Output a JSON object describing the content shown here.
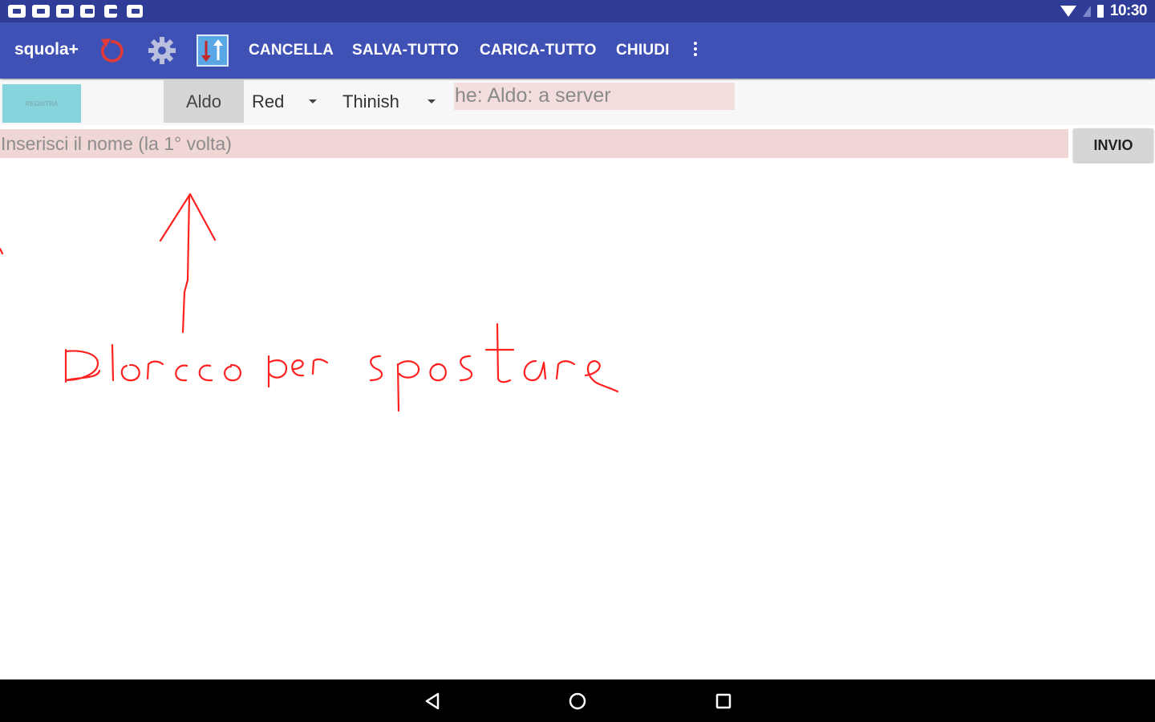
{
  "status_bar": {
    "time": "10:30",
    "notification_icons": [
      "app-notification-icon",
      "app-notification-icon",
      "app-notification-icon",
      "app-notification-icon",
      "app-notification-icon",
      "app-notification-icon"
    ],
    "icons": [
      "wifi-icon",
      "signal-icon",
      "battery-icon"
    ]
  },
  "toolbar": {
    "title": "squola+",
    "icons": [
      "undo-icon",
      "gear-icon",
      "transfer-icon"
    ],
    "actions": {
      "cancella": "CANCELLA",
      "salva_tutto": "SALVA-TUTTO",
      "carica_tutto": "CARICA-TUTTO",
      "chiudi": "CHIUDI"
    },
    "overflow_icon": "more-vert-icon"
  },
  "row1": {
    "registra_label": "REGISTRA",
    "user_name": "Aldo",
    "color_select": "Red",
    "thickness_select": "Thinish",
    "message": "he: Aldo: a server"
  },
  "row2": {
    "name_placeholder": "Inserisci il nome (la 1° volta)",
    "invio_label": "INVIO"
  },
  "canvas": {
    "stroke_color": "#ff2020",
    "handwritten_text": "blocco per spostare"
  },
  "colors": {
    "status_bar": "#2f3c98",
    "toolbar": "#3f51b5",
    "accent_red": "#e53935",
    "message_bg": "#f3dddd",
    "registra_bg": "#86d4dc",
    "nav_bar": "#000000"
  },
  "nav_bar": {
    "icons": [
      "back-icon",
      "home-icon",
      "recents-icon"
    ]
  }
}
